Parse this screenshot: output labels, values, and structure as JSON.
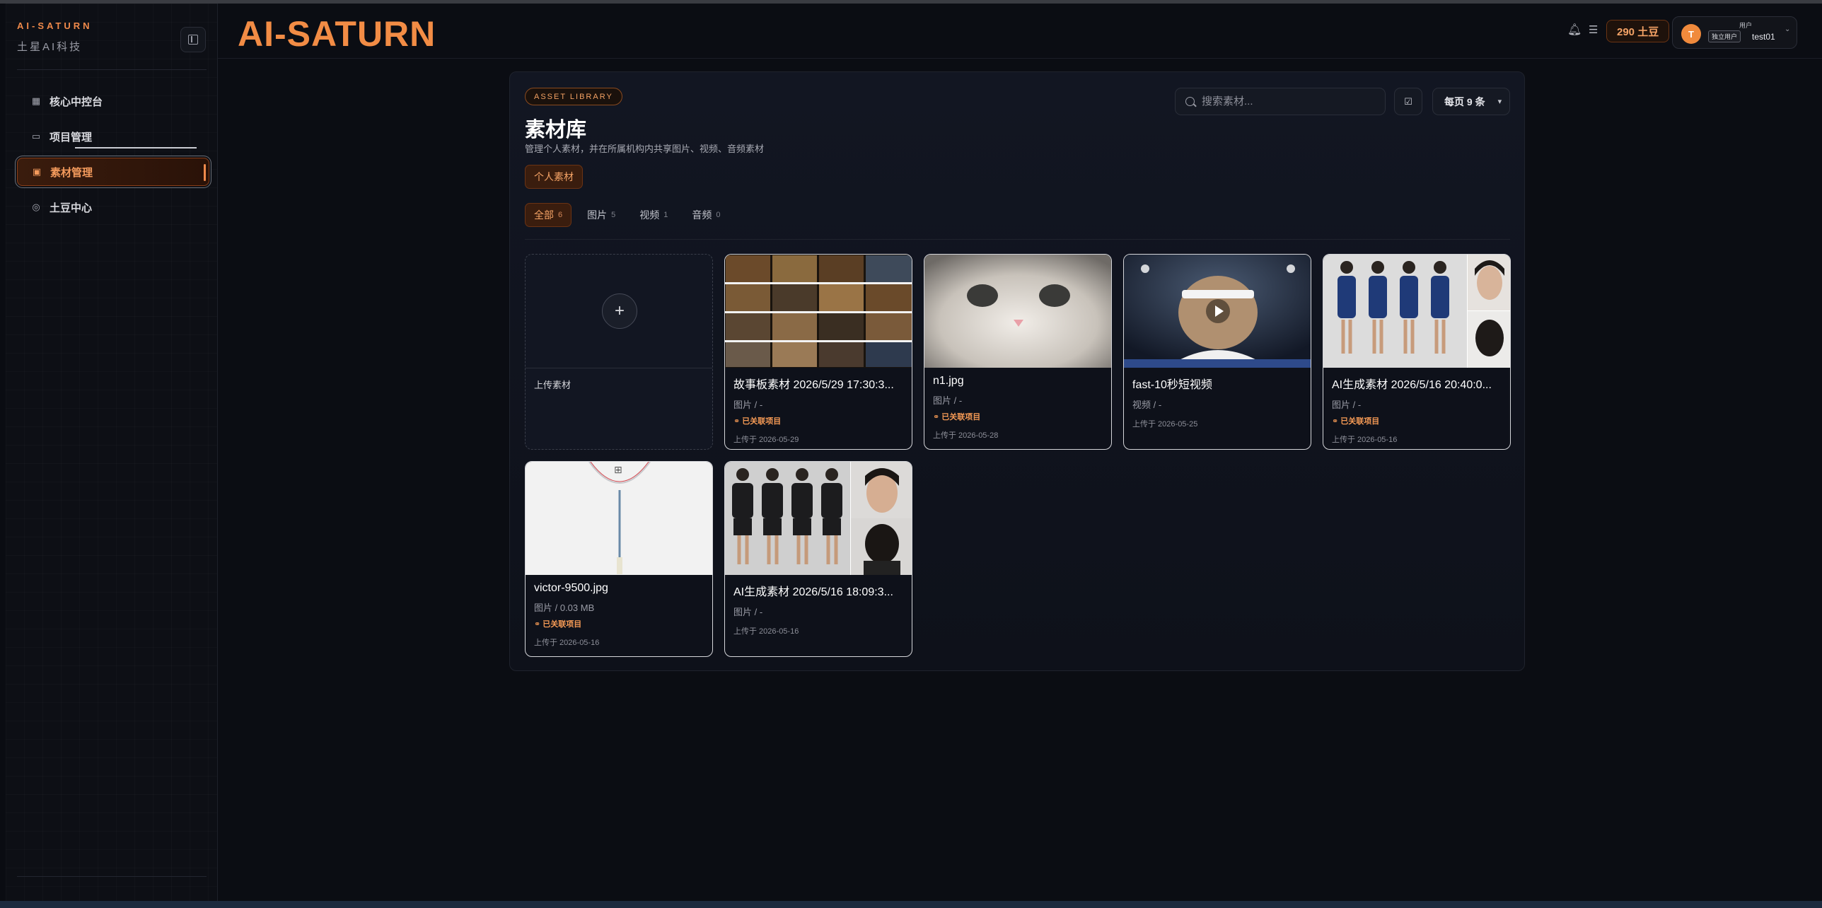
{
  "sidebar": {
    "brand": "AI-SATURN",
    "brand_sub": "土星AI科技",
    "items": [
      {
        "label": "核心中控台",
        "icon": "grid-icon"
      },
      {
        "label": "项目管理",
        "icon": "folder-icon"
      },
      {
        "label": "素材管理",
        "icon": "image-icon",
        "active": true
      },
      {
        "label": "土豆中心",
        "icon": "coin-icon"
      }
    ]
  },
  "header": {
    "title": "AI-SATURN",
    "coins": "290 土豆",
    "user": {
      "avatar": "T",
      "role": "用户",
      "badge": "独立用户",
      "name": "test01"
    }
  },
  "library": {
    "tag": "ASSET LIBRARY",
    "title": "素材库",
    "description": "管理个人素材，并在所属机构内共享图片、视频、音频素材",
    "search_placeholder": "搜索素材...",
    "per_page": "每页 9 条",
    "scope_button": "个人素材",
    "tabs": [
      {
        "label": "全部",
        "count": "6",
        "active": true
      },
      {
        "label": "图片",
        "count": "5"
      },
      {
        "label": "视频",
        "count": "1"
      },
      {
        "label": "音频",
        "count": "0"
      }
    ],
    "upload_label": "上传素材",
    "cards": [
      {
        "name": "故事板素材 2026/5/29 17:30:3...",
        "meta": "图片 / -",
        "linked": "已关联项目",
        "date": "上传于 2026-05-29"
      },
      {
        "name": "n1.jpg",
        "meta": "图片 / -",
        "linked": "已关联项目",
        "date": "上传于 2026-05-28"
      },
      {
        "name": "fast-10秒短视频",
        "meta": "视频 / -",
        "date": "上传于 2026-05-25"
      },
      {
        "name": "AI生成素材 2026/5/16 20:40:0...",
        "meta": "图片 / -",
        "linked": "已关联项目",
        "date": "上传于 2026-05-16"
      },
      {
        "name": "victor-9500.jpg",
        "meta": "图片 / 0.03 MB",
        "linked": "已关联项目",
        "date": "上传于 2026-05-16"
      },
      {
        "name": "AI生成素材 2026/5/16 18:09:3...",
        "meta": "图片 / -",
        "date": "上传于 2026-05-16"
      }
    ]
  },
  "colors": {
    "accent": "#f28c45",
    "background": "#0b0d13"
  }
}
